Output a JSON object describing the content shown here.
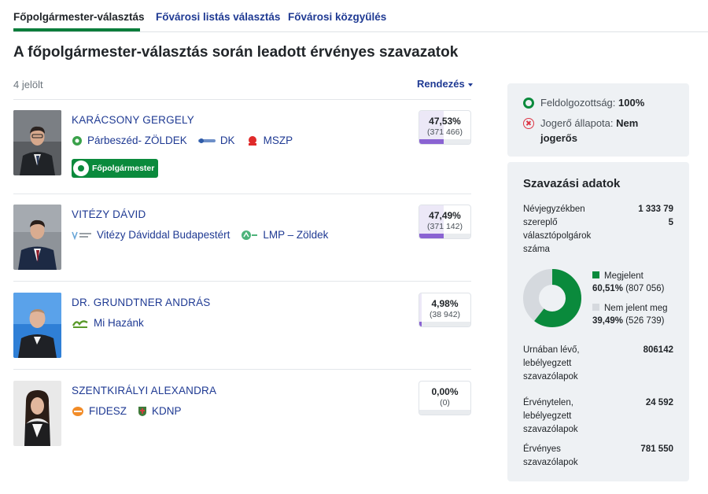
{
  "tabs": [
    {
      "label": "Főpolgármester-választás",
      "active": true
    },
    {
      "label": "Fővárosi listás választás",
      "active": false
    },
    {
      "label": "Fővárosi közgyűlés",
      "active": false
    }
  ],
  "page_title": "A főpolgármester-választás során leadott érvényes szavazatok",
  "candidate_count": "4 jelölt",
  "sort_label": "Rendezés",
  "winner_badge": "Főpolgármester",
  "candidates": [
    {
      "name": "KARÁCSONY GERGELY",
      "parties": [
        {
          "name": "Párbeszéd- ZÖLDEK",
          "logo": "parbeszed-logo"
        },
        {
          "name": "DK",
          "logo": "dk-logo"
        },
        {
          "name": "MSZP",
          "logo": "mszp-logo"
        }
      ],
      "percent": "47,53%",
      "percent_value": 47.53,
      "votes": "(371 466)",
      "winner": true
    },
    {
      "name": "VITÉZY DÁVID",
      "parties": [
        {
          "name": "Vitézy Dáviddal Budapestért",
          "logo": "vitezy-logo"
        },
        {
          "name": "LMP – Zöldek",
          "logo": "lmp-logo"
        }
      ],
      "percent": "47,49%",
      "percent_value": 47.49,
      "votes": "(371 142)",
      "winner": false
    },
    {
      "name": "DR. GRUNDTNER ANDRÁS",
      "parties": [
        {
          "name": "Mi Hazánk",
          "logo": "mi-hazank-logo"
        }
      ],
      "percent": "4,98%",
      "percent_value": 4.98,
      "votes": "(38 942)",
      "winner": false
    },
    {
      "name": "SZENTKIRÁLYI ALEXANDRA",
      "parties": [
        {
          "name": "FIDESZ",
          "logo": "fidesz-logo"
        },
        {
          "name": "KDNP",
          "logo": "kdnp-logo"
        }
      ],
      "percent": "0,00%",
      "percent_value": 0.0,
      "votes": "(0)",
      "winner": false
    }
  ],
  "status": {
    "processed_label": "Feldolgozottság:",
    "processed_value": "100%",
    "legal_label": "Jogerő állapota:",
    "legal_value_1": "Nem",
    "legal_value_2": "jogerős"
  },
  "voting_data": {
    "title": "Szavazási adatok",
    "registered_label_lines": [
      "Névjegyzékben",
      "szereplő",
      "választópolgárok",
      "száma"
    ],
    "registered_value_lines": [
      "1 333 79",
      "5"
    ],
    "turnout": {
      "present_label": "Megjelent",
      "present_pct": "60,51%",
      "present_count": "(807 056)",
      "present_value": 60.51,
      "absent_label": "Nem jelent meg",
      "absent_pct": "39,49%",
      "absent_count": "(526 739)",
      "absent_value": 39.49,
      "present_color": "#0a8a3c",
      "absent_color": "#d5d9de"
    },
    "stamped_label_lines": [
      "Urnában lévő,",
      "lebélyegzett",
      "szavazólapok"
    ],
    "stamped_value": "806142",
    "invalid_label_lines": [
      "Érvénytelen,",
      "lebélyegzett",
      "szavazólapok"
    ],
    "invalid_value": "24 592",
    "valid_label_lines": [
      "Érvényes",
      "szavazólapok"
    ],
    "valid_value": "781 550"
  },
  "colors": {
    "link": "#1f3a93",
    "accent_green": "#0a8a3c",
    "vote_bar": "#8a63d2",
    "panel_bg": "#eef1f4"
  }
}
